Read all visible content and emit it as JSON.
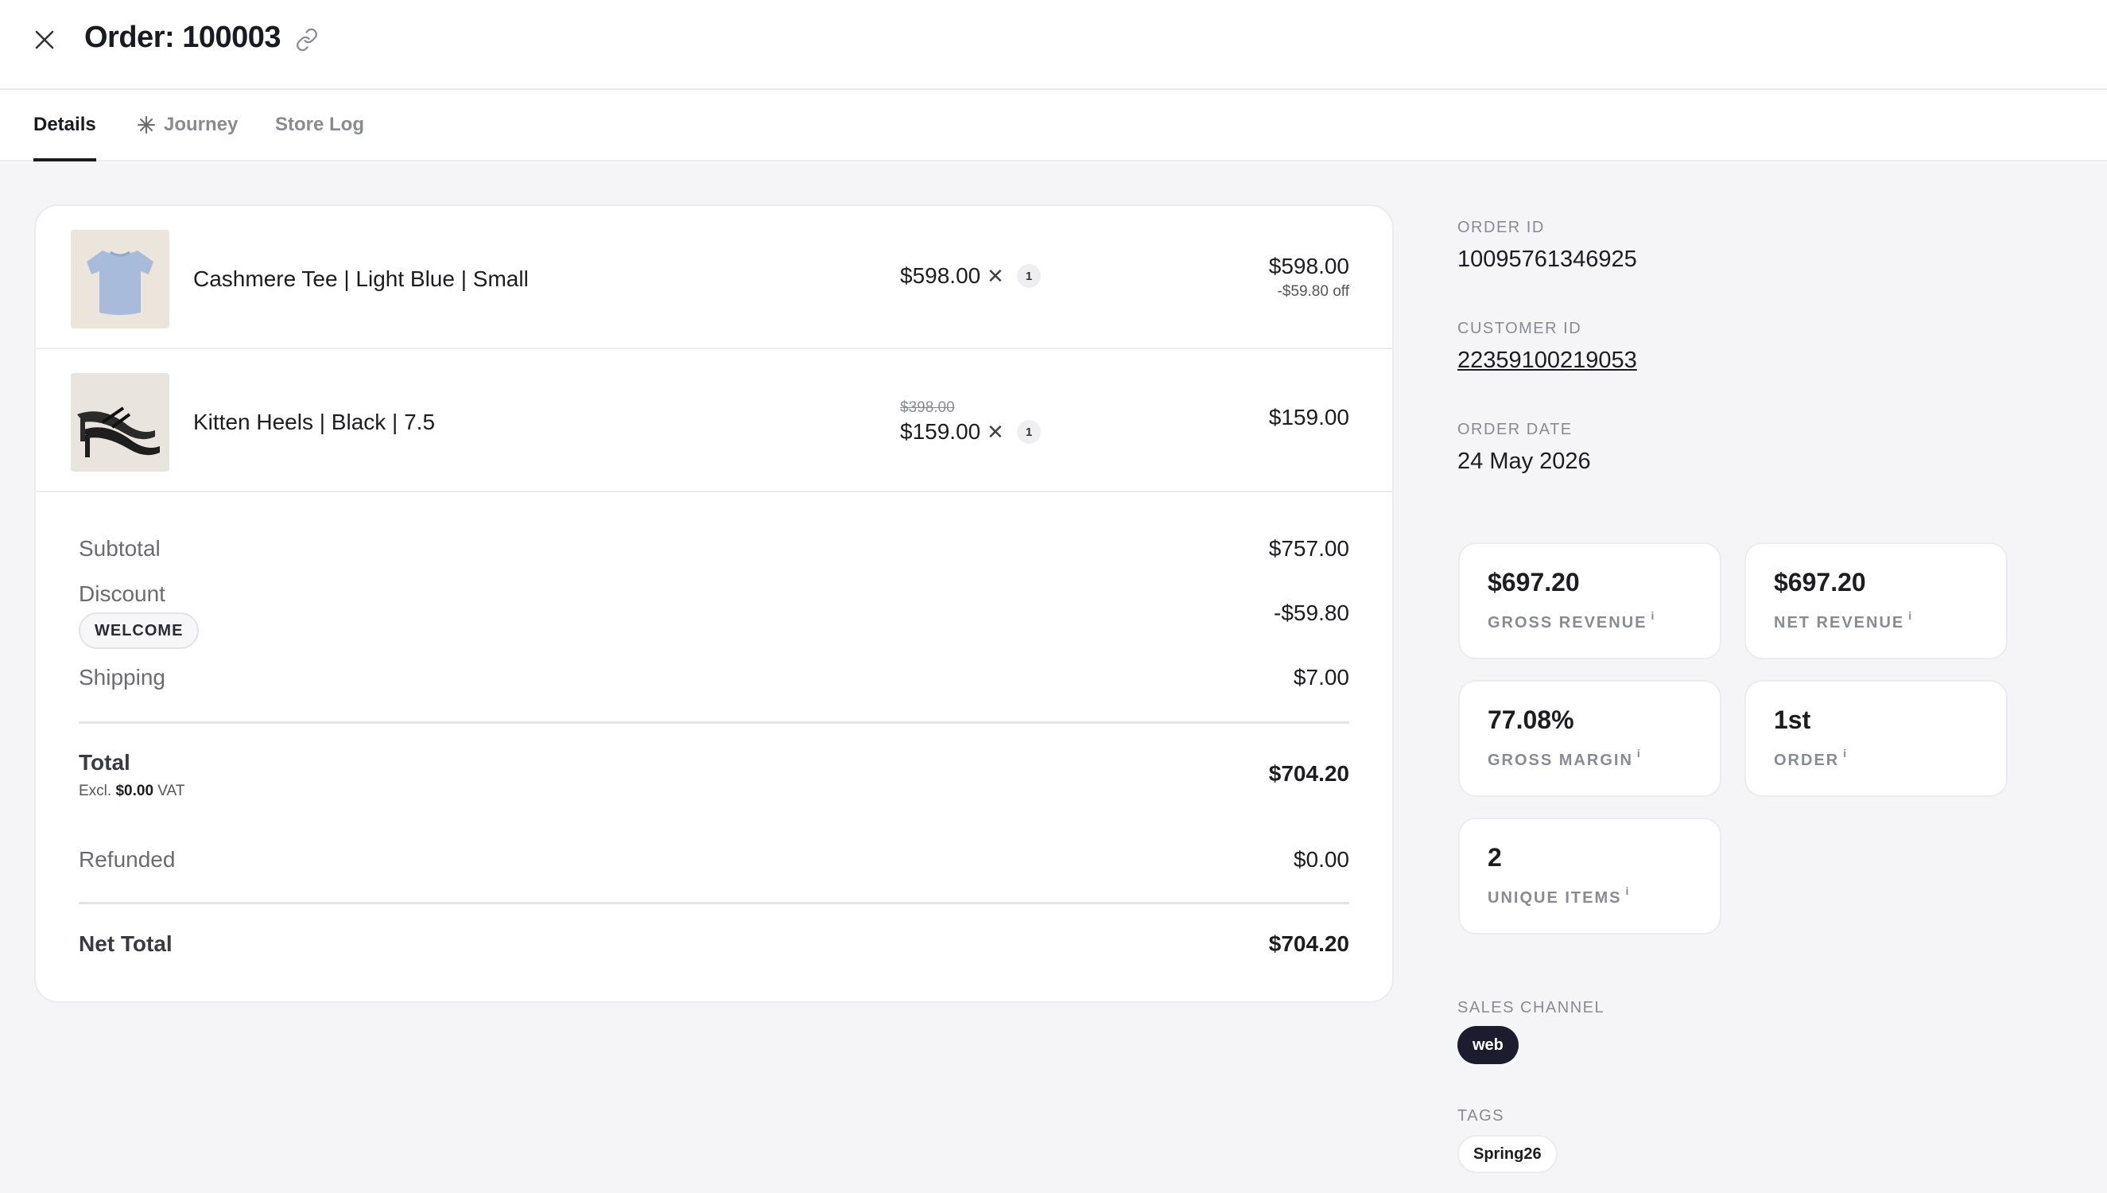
{
  "header": {
    "title": "Order: 100003"
  },
  "tabs": [
    {
      "label": "Details",
      "active": true
    },
    {
      "label": "Journey",
      "icon": "sparkle-icon"
    },
    {
      "label": "Store Log"
    }
  ],
  "items": [
    {
      "name": "Cashmere Tee | Light Blue | Small",
      "unit_price": "$598.00",
      "times": "✕",
      "quantity": "1",
      "line_total": "$598.00",
      "line_discount": "-$59.80 off"
    },
    {
      "name": "Kitten Heels | Black | 7.5",
      "original_price": "$398.00",
      "unit_price": "$159.00",
      "times": "✕",
      "quantity": "1",
      "line_total": "$159.00"
    }
  ],
  "summary": {
    "subtotal_label": "Subtotal",
    "subtotal_value": "$757.00",
    "discount_label": "Discount",
    "discount_code": "WELCOME",
    "discount_value": "-$59.80",
    "shipping_label": "Shipping",
    "shipping_value": "$7.00",
    "total_label": "Total",
    "vat_prefix": "Excl.",
    "vat_amount": "$0.00",
    "vat_suffix": "VAT",
    "total_value": "$704.20",
    "refunded_label": "Refunded",
    "refunded_value": "$0.00",
    "net_total_label": "Net Total",
    "net_total_value": "$704.20"
  },
  "meta": {
    "order_id_label": "ORDER ID",
    "order_id": "10095761346925",
    "customer_id_label": "CUSTOMER ID",
    "customer_id": "22359100219053",
    "order_date_label": "ORDER DATE",
    "order_date": "24 May 2026",
    "sales_channel_label": "SALES CHANNEL",
    "sales_channel": "web",
    "tags_label": "TAGS",
    "tags": [
      "Spring26"
    ]
  },
  "stats": [
    {
      "value": "$697.20",
      "label": "GROSS REVENUE",
      "info": "i"
    },
    {
      "value": "$697.20",
      "label": "NET REVENUE",
      "info": "i"
    },
    {
      "value": "77.08%",
      "label": "GROSS MARGIN",
      "info": "i"
    },
    {
      "value": "1st",
      "label": "ORDER",
      "info": "i"
    },
    {
      "value": "2",
      "label": "UNIQUE ITEMS",
      "info": "i"
    }
  ]
}
